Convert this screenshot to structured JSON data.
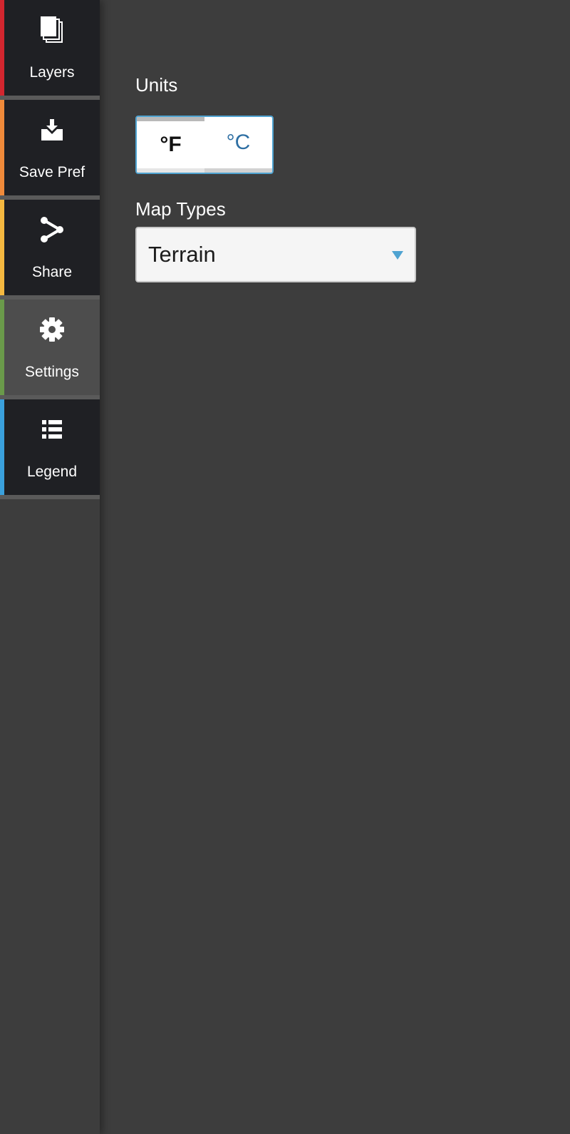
{
  "sidebar": {
    "items": [
      {
        "label": "Layers",
        "icon": "layers-icon",
        "accent": "#d2262f",
        "active": false
      },
      {
        "label": "Save Pref",
        "icon": "download-tray-icon",
        "accent": "#f08a3a",
        "active": false
      },
      {
        "label": "Share",
        "icon": "share-icon",
        "accent": "#f5b840",
        "active": false
      },
      {
        "label": "Settings",
        "icon": "gear-icon",
        "accent": "#6a9a4a",
        "active": true
      },
      {
        "label": "Legend",
        "icon": "list-icon",
        "accent": "#3aa0dc",
        "active": false
      }
    ]
  },
  "settings": {
    "units": {
      "label": "Units",
      "options": [
        "°F",
        "°C"
      ],
      "selected": "°F"
    },
    "map_types": {
      "label": "Map Types",
      "selected": "Terrain"
    }
  },
  "colors": {
    "background": "#3d3d3d",
    "nav_background": "#1f2024",
    "nav_active": "#4d4d4d",
    "accent_blue": "#4fa3d1",
    "celsius_text": "#2e6fa3"
  }
}
